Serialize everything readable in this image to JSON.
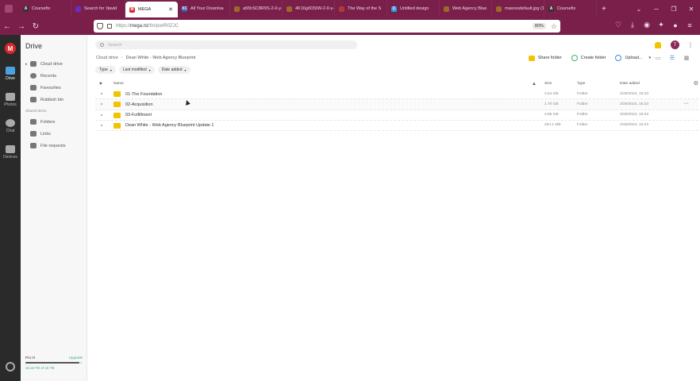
{
  "browser": {
    "tabs": [
      {
        "label": "Coursefix",
        "color": "#333333",
        "glyph": "A"
      },
      {
        "label": "Search for 'david",
        "color": "#6a2cc7",
        "glyph": ""
      },
      {
        "label": "MEGA",
        "color": "#d9272e",
        "glyph": "M",
        "active": true
      },
      {
        "label": "All Your Downloa",
        "color": "#3d5ab8",
        "glyph": "XC"
      },
      {
        "label": "a55hSC8R9S-2-0-y-6r",
        "color": "#9a6a2a",
        "glyph": ""
      },
      {
        "label": "4K16g0O5IW-2-0-y-6r",
        "color": "#9a6a2a",
        "glyph": ""
      },
      {
        "label": "The Way of the S",
        "color": "#b03a3a",
        "glyph": ""
      },
      {
        "label": "Untitled design",
        "color": "#2aa0e0",
        "glyph": "C"
      },
      {
        "label": "Web Agency Blue",
        "color": "#9a6a2a",
        "glyph": ""
      },
      {
        "label": "maxresdefault.jpg (1",
        "color": "#9a6a2a",
        "glyph": ""
      },
      {
        "label": "Coursefix",
        "color": "#333333",
        "glyph": "A"
      }
    ],
    "new_tab": "+",
    "url_prefix": "https://",
    "url_host": "mega.nz",
    "url_path": "/fm/pwIR0ZJC",
    "zoom": "80%"
  },
  "rail": {
    "logo": "M",
    "items": [
      {
        "label": "Drive",
        "active": true
      },
      {
        "label": "Photos"
      },
      {
        "label": "Chat"
      },
      {
        "label": "Devices"
      }
    ]
  },
  "sidebar": {
    "title": "Drive",
    "items": [
      {
        "label": "Cloud drive"
      },
      {
        "label": "Recents"
      },
      {
        "label": "Favourites"
      },
      {
        "label": "Rubbish bin"
      }
    ],
    "shared_section": "Shared items",
    "shared_items": [
      {
        "label": "Folders"
      },
      {
        "label": "Links"
      },
      {
        "label": "File requests"
      }
    ],
    "storage": {
      "plan": "Pro III",
      "upgrade": "Upgrade",
      "used": "16.16 TB of 16 TB",
      "fraction": 0.95
    }
  },
  "main": {
    "search_placeholder": "Search",
    "avatar_initial": "T",
    "breadcrumb": [
      "Cloud drive",
      "Dean White - Web Agency Blueprint"
    ],
    "actions": {
      "share": "Share folder",
      "create": "Create folder",
      "upload": "Upload..."
    },
    "filters": [
      "Type",
      "Last modified",
      "Date added"
    ],
    "columns": {
      "name": "Name",
      "size": "Size",
      "type": "Type",
      "date": "Date added"
    },
    "rows": [
      {
        "name": "01-The Foundation",
        "size": "3.54 GB",
        "type": "Folder",
        "date": "2/26/2024, 15:23"
      },
      {
        "name": "02-Acquisition",
        "size": "1.70 GB",
        "type": "Folder",
        "date": "2/26/2024, 15:23"
      },
      {
        "name": "03-Fulfillment",
        "size": "3.86 GB",
        "type": "Folder",
        "date": "2/26/2024, 15:23"
      },
      {
        "name": "Dean White - Web Agency Blueprint Update 1",
        "size": "254.1 MB",
        "type": "Folder",
        "date": "2/26/2024, 15:23"
      }
    ]
  }
}
